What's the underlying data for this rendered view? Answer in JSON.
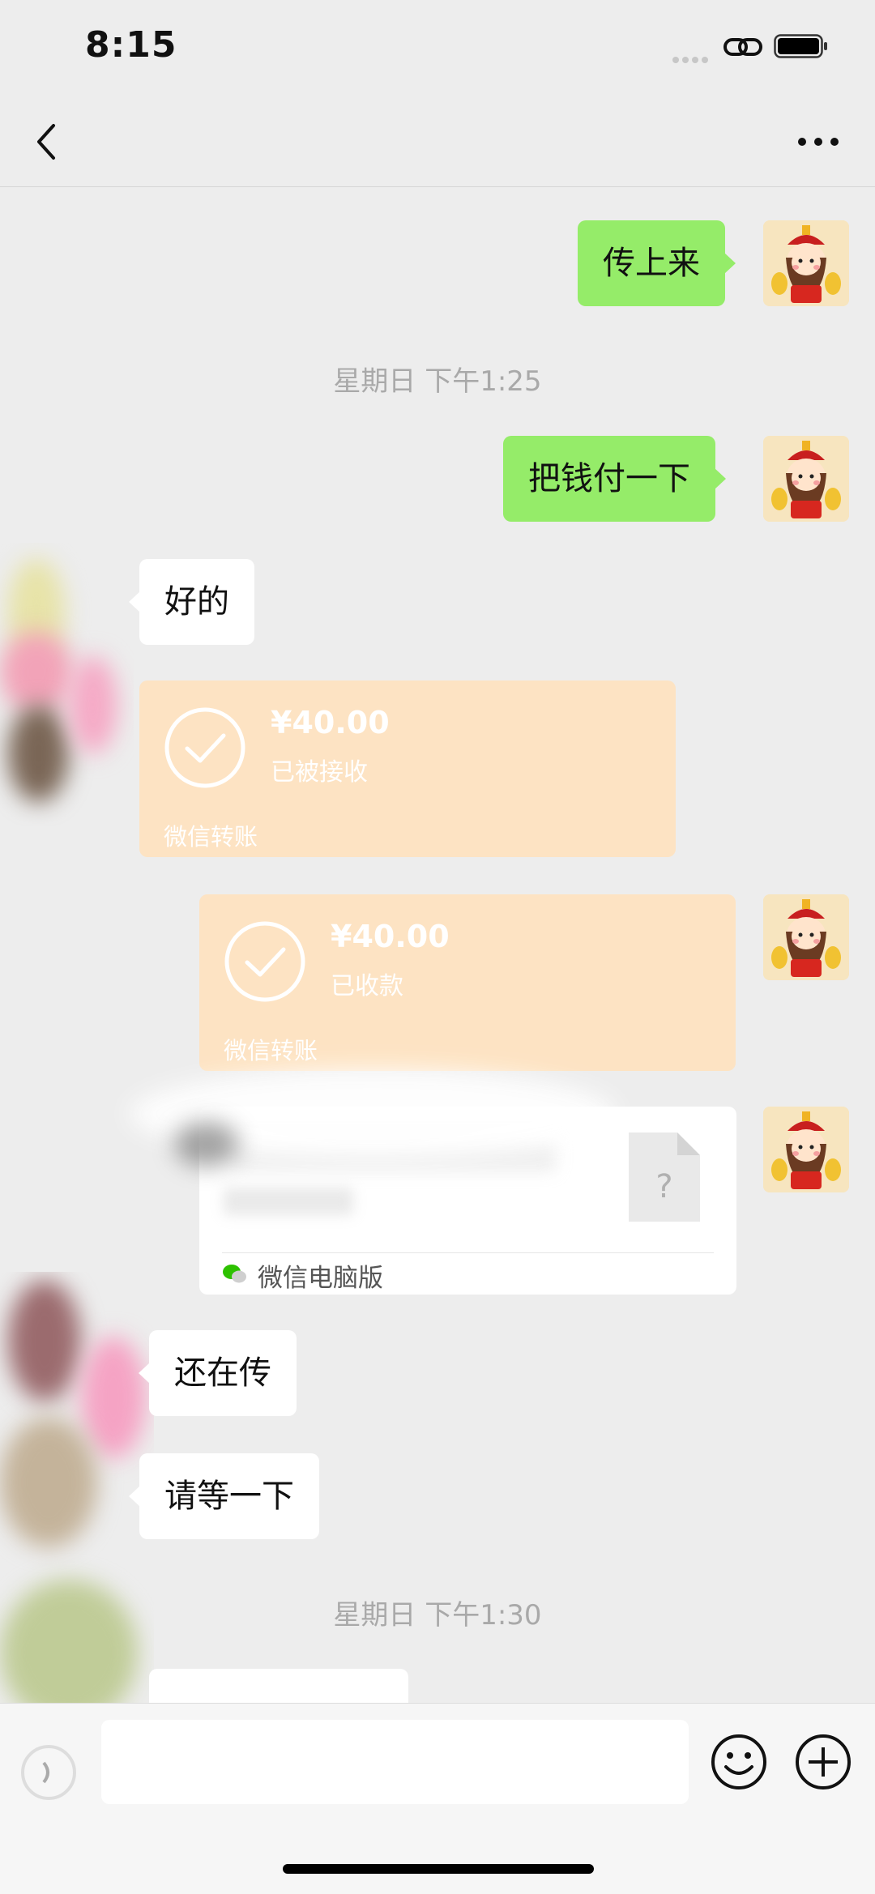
{
  "status_bar": {
    "time": "8:15"
  },
  "nav": {
    "back_icon": "chevron-left-icon",
    "more_icon": "more-dots-icon"
  },
  "messages": [
    {
      "side": "me",
      "text": "传上来"
    },
    {
      "timestamp": "星期日 下午1:25"
    },
    {
      "side": "me",
      "text": "把钱付一下"
    },
    {
      "side": "other",
      "text": "好的"
    },
    {
      "side": "other",
      "type": "transfer",
      "amount": "¥40.00",
      "status": "已被接收",
      "label": "微信转账"
    },
    {
      "side": "me",
      "type": "transfer",
      "amount": "¥40.00",
      "status": "已收款",
      "label": "微信转账"
    },
    {
      "side": "me",
      "type": "file",
      "source": "微信电脑版",
      "icon": "question-file-icon"
    },
    {
      "side": "other",
      "text": "还在传"
    },
    {
      "side": "other",
      "text": "请等一下"
    },
    {
      "timestamp": "星期日 下午1:30"
    }
  ],
  "input_bar": {
    "voice_icon": "voice-icon",
    "emoji_icon": "emoji-icon",
    "plus_icon": "plus-icon",
    "input_value": ""
  },
  "colors": {
    "background": "#ededed",
    "my_bubble": "#95ec69",
    "their_bubble": "#ffffff",
    "transfer_card": "#fde3c3",
    "timestamp_text": "#a9a9a9"
  }
}
